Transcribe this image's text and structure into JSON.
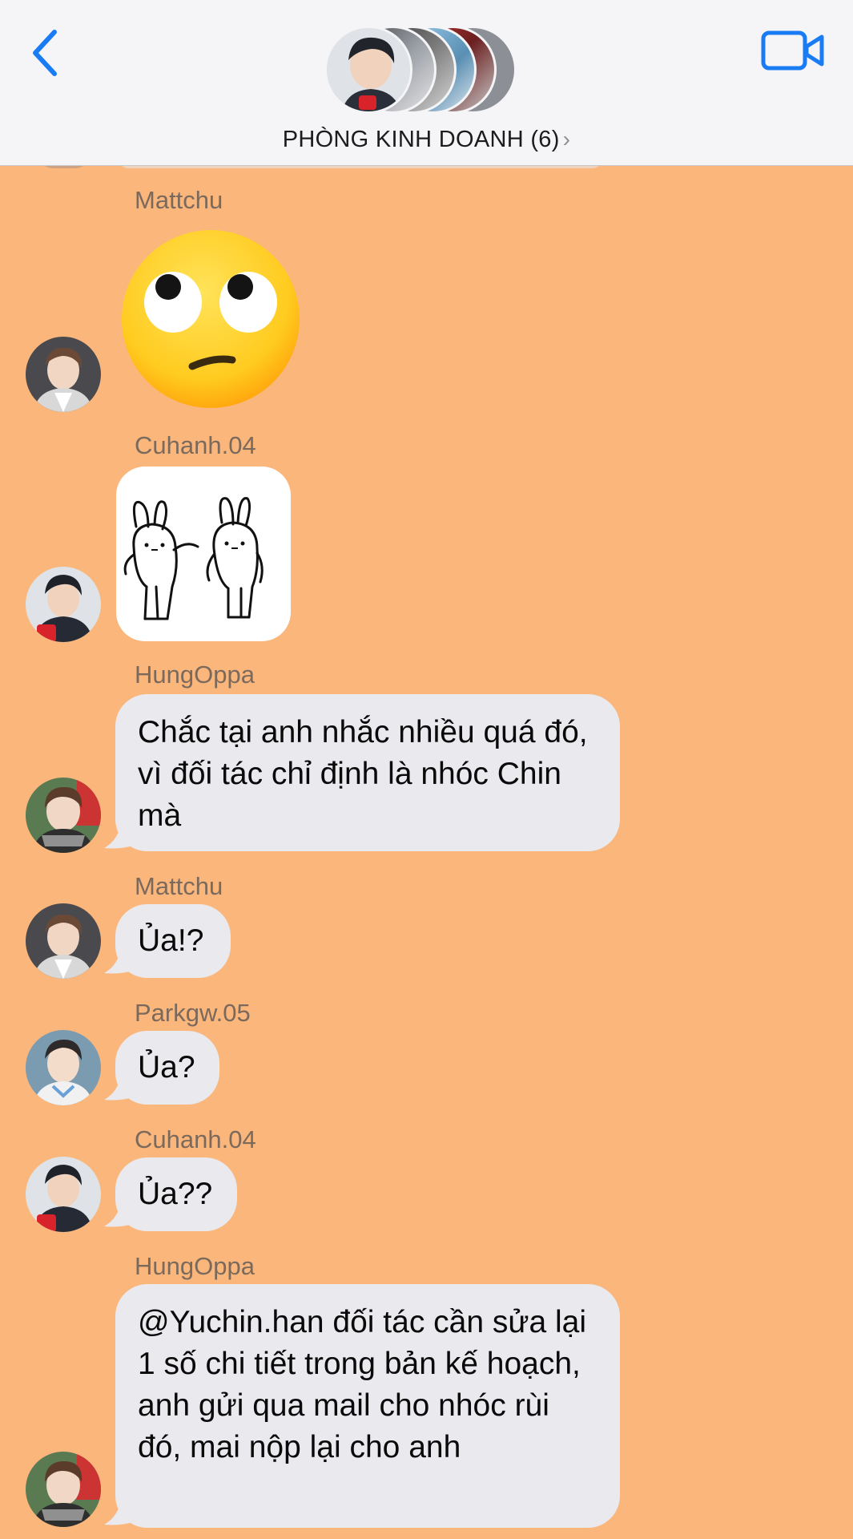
{
  "header": {
    "title": "PHÒNG KINH DOANH (6)",
    "chevron": "›",
    "back_icon": "chevron-left-icon",
    "video_icon": "video-camera-icon",
    "accent_color": "#1a7cf5"
  },
  "chat_background": "#fbb67c",
  "messages": [
    {
      "sender": "Mattchu",
      "type": "emoji",
      "emoji": "face-with-rolling-eyes"
    },
    {
      "sender": "Cuhanh.04",
      "type": "sticker",
      "sticker": "two-bunnies-sticker"
    },
    {
      "sender": "HungOppa",
      "type": "text",
      "text": "Chắc tại anh nhắc nhiều quá đó, vì đối tác chỉ định là nhóc Chin mà"
    },
    {
      "sender": "Mattchu",
      "type": "text",
      "text": "Ủa!?"
    },
    {
      "sender": "Parkgw.05",
      "type": "text",
      "text": "Ủa?"
    },
    {
      "sender": "Cuhanh.04",
      "type": "text",
      "text": "Ủa??"
    },
    {
      "sender": "HungOppa",
      "type": "text",
      "text": "@Yuchin.han đối tác cần sửa lại 1 số chi tiết trong bản kế hoạch, anh gửi qua mail cho nhóc rùi đó, mai nộp lại cho anh"
    }
  ]
}
